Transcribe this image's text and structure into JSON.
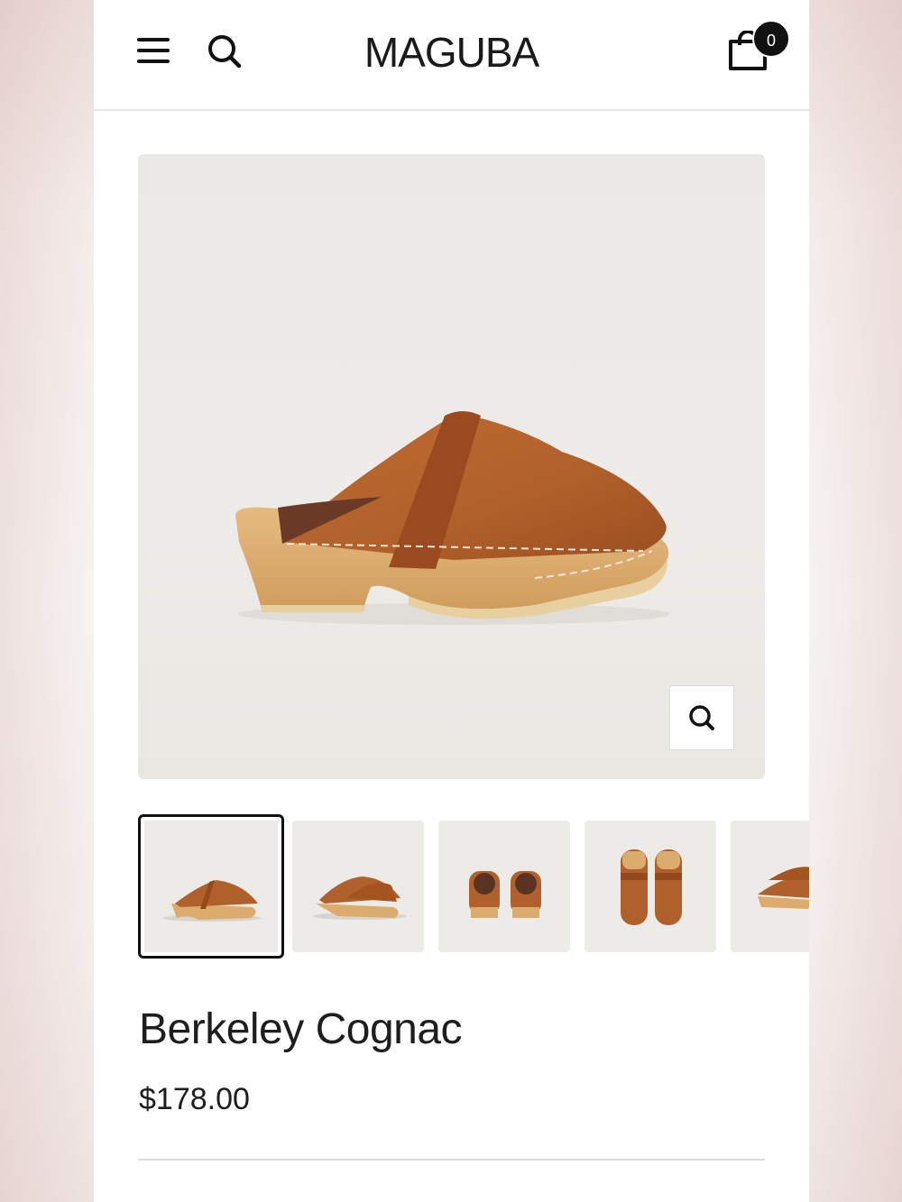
{
  "header": {
    "logo_text": "MAGUBA",
    "cart_count": "0",
    "icons": [
      "hamburger-menu-icon",
      "search-icon",
      "cart-icon"
    ]
  },
  "product": {
    "title": "Berkeley Cognac",
    "price": "$178.00",
    "main_image": {
      "alt": "Berkeley Cognac clog side view",
      "colors": {
        "leather": "#b0602a",
        "leather_dark": "#94491c",
        "wood": "#dcab6e"
      }
    },
    "thumbnails": [
      {
        "view": "side"
      },
      {
        "view": "three-quarter"
      },
      {
        "view": "back"
      },
      {
        "view": "front-top"
      },
      {
        "view": "side-pair"
      }
    ],
    "zoom_icon": "zoom-icon"
  }
}
